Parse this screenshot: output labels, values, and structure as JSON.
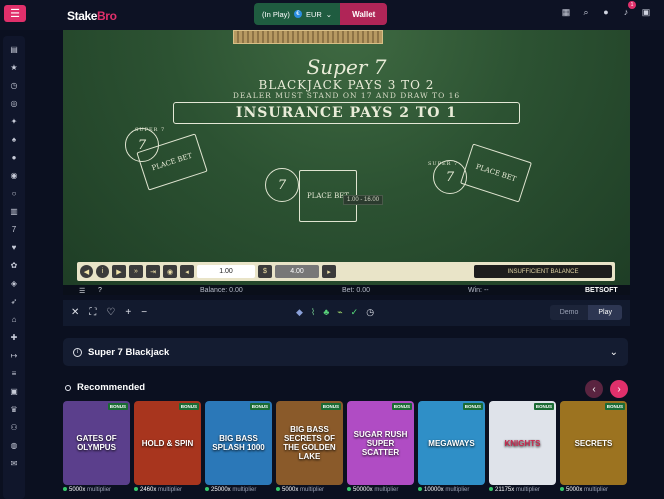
{
  "header": {
    "logo_a": "Stake",
    "logo_b": "Bro",
    "currency_label": "(In Play)",
    "currency_code": "EUR",
    "wallet_label": "Wallet",
    "notification_count": "1"
  },
  "game": {
    "title": "Super 7",
    "rules_line1": "BLACKJACK PAYS 3 TO 2",
    "rules_line2": "DEALER MUST STAND ON 17 AND DRAW TO 16",
    "insurance": "INSURANCE PAYS 2 TO 1",
    "super7_label": "SUPER 7",
    "place_bet": "PLACE BET",
    "seven": "7",
    "range_tip": "1.00 - 16.00",
    "chip_value": "1.00",
    "stake_value": "4.00",
    "insufficient": "INSUFFICIENT BALANCE",
    "balance": "Balance: 0.00",
    "bet": "Bet: 0.00",
    "win": "Win: --",
    "provider": "BETSOFT"
  },
  "toolbar": {
    "demo": "Demo",
    "play": "Play"
  },
  "info": {
    "title": "Super 7 Blackjack"
  },
  "recommended": {
    "title": "Recommended",
    "cards": [
      {
        "name": "GATES OF OLYMPUS",
        "multiplier": "5000x",
        "bonus": "BONUS",
        "color": "#5b3f8c"
      },
      {
        "name": "HOLD & SPIN",
        "multiplier": "2460x",
        "bonus": "BONUS",
        "color": "#a8351e"
      },
      {
        "name": "BIG BASS SPLASH 1000",
        "multiplier": "25000x",
        "bonus": "BONUS",
        "color": "#2b78b8"
      },
      {
        "name": "BIG BASS SECRETS OF THE GOLDEN LAKE",
        "multiplier": "5000x",
        "bonus": "BONUS",
        "color": "#8a5a2a"
      },
      {
        "name": "SUGAR RUSH SUPER SCATTER",
        "multiplier": "50000x",
        "bonus": "BONUS",
        "color": "#b04cc4"
      },
      {
        "name": "MEGAWAYS",
        "multiplier": "10000x",
        "bonus": "BONUS",
        "color": "#2f8fc7"
      },
      {
        "name": "KNIGHTS",
        "multiplier": "21175x",
        "bonus": "BONUS",
        "color": "#dfe3ea"
      },
      {
        "name": "SECRETS",
        "multiplier": "5000x",
        "bonus": "BONUS",
        "color": "#9c7320"
      }
    ],
    "multiplier_suffix": "multiplier"
  },
  "sidebar": {
    "icons": [
      "home-icon",
      "star-icon",
      "history-icon",
      "spin-icon",
      "crown-icon",
      "cards-icon",
      "user-icon",
      "chip-icon",
      "circle-icon",
      "slots-icon",
      "seven-icon",
      "heart-icon",
      "gift-icon",
      "live-icon",
      "rocket-icon",
      "cake-icon",
      "plus-icon",
      "arrow-icon",
      "list-icon",
      "gamepad-icon",
      "trophy-icon",
      "users-icon",
      "globe-icon",
      "chat-icon"
    ]
  },
  "colors": {
    "accent": "#e0306b",
    "felt": "#2c5232",
    "background": "#0b1020"
  }
}
